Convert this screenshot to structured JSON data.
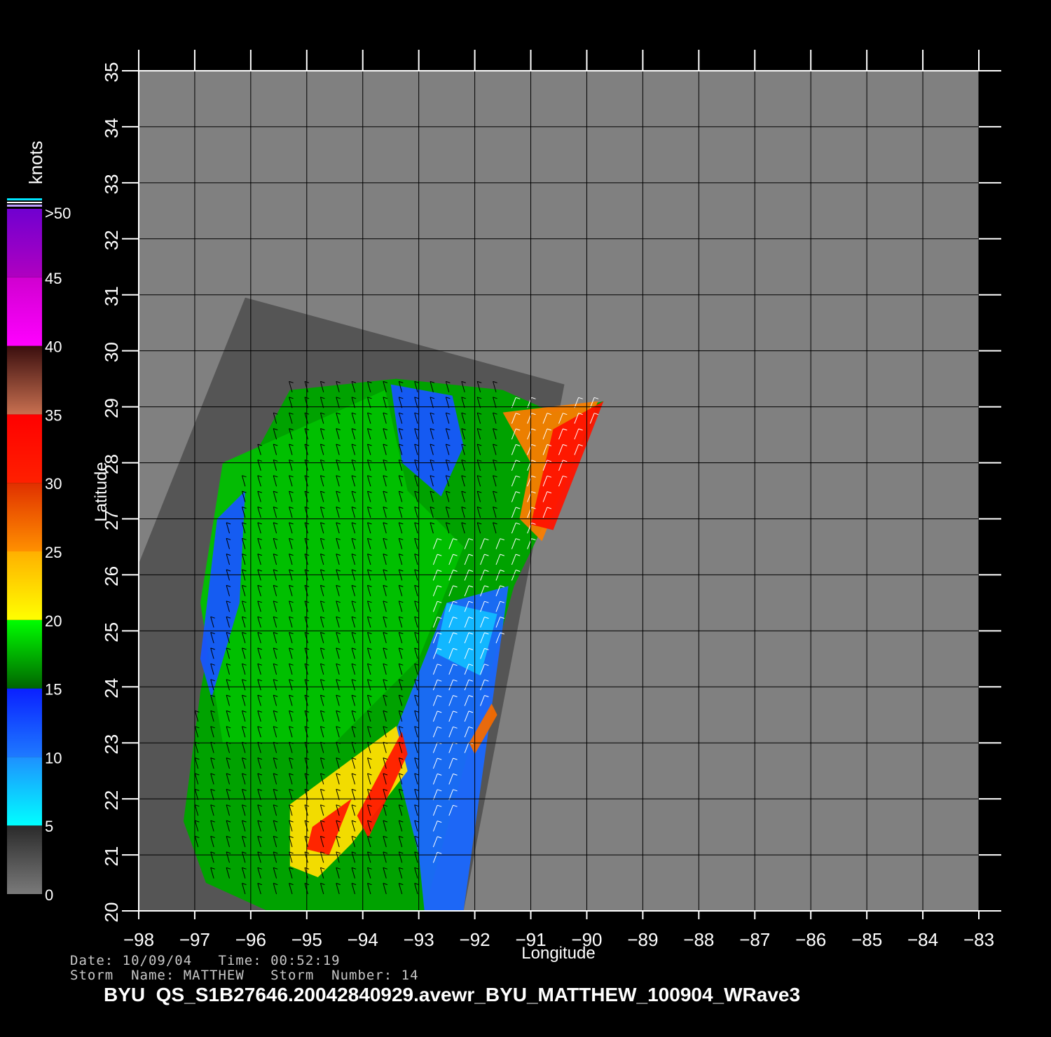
{
  "map": {
    "type": "scatterometer-wind-map",
    "xlabel": "Longitude",
    "ylabel": "Latitude",
    "lon_range": [
      -98,
      -83
    ],
    "lat_range": [
      20,
      35
    ],
    "lon_ticks": [
      "−98",
      "−97",
      "−96",
      "−95",
      "−94",
      "−93",
      "−92",
      "−91",
      "−90",
      "−89",
      "−88",
      "−87",
      "−86",
      "−85",
      "−84",
      "−83"
    ],
    "lat_ticks": [
      "20",
      "21",
      "22",
      "23",
      "24",
      "25",
      "26",
      "27",
      "28",
      "29",
      "30",
      "31",
      "32",
      "33",
      "34",
      "35"
    ],
    "grid": true,
    "background_color": "#808080",
    "land_color": "#555555"
  },
  "colorbar": {
    "unit_label": "knots",
    "tick_labels": [
      ">50",
      "45",
      "40",
      "35",
      "30",
      "25",
      "20",
      "15",
      "10",
      "5",
      "0"
    ],
    "segments": [
      {
        "from": 0,
        "to": 5,
        "colors": [
          "#7a7a7a",
          "#2a2a2a"
        ]
      },
      {
        "from": 5,
        "to": 10,
        "colors": [
          "#00ffff",
          "#1e90ff"
        ]
      },
      {
        "from": 10,
        "to": 15,
        "colors": [
          "#1e7aff",
          "#0a20ff"
        ]
      },
      {
        "from": 15,
        "to": 20,
        "colors": [
          "#006400",
          "#00ff00"
        ]
      },
      {
        "from": 20,
        "to": 25,
        "colors": [
          "#ffff00",
          "#ffb000"
        ]
      },
      {
        "from": 25,
        "to": 30,
        "colors": [
          "#ff9000",
          "#e03000"
        ]
      },
      {
        "from": 30,
        "to": 35,
        "colors": [
          "#ff2000",
          "#ff0000"
        ]
      },
      {
        "from": 35,
        "to": 40,
        "colors": [
          "#c87050",
          "#3a0e0e"
        ]
      },
      {
        "from": 40,
        "to": 45,
        "colors": [
          "#ff00ff",
          "#d000d0"
        ]
      },
      {
        "from": 45,
        "to": 50,
        "colors": [
          "#b000c0",
          "#7000d0"
        ]
      }
    ]
  },
  "info": {
    "line1": "Date: 10/09/04   Time: 00:52:19",
    "line2": "Storm  Name: MATTHEW   Storm  Number: 14"
  },
  "title": "BYU  QS_S1B27646.20042840929.avewr_BYU_MATTHEW_100904_WRave3",
  "chart_data": {
    "type": "heatmap",
    "title": "BYU  QS_S1B27646.20042840929.avewr_BYU_MATTHEW_100904_WRave3",
    "xlabel": "Longitude",
    "ylabel": "Latitude",
    "xlim": [
      -98,
      -83
    ],
    "ylim": [
      20,
      35
    ],
    "color_unit": "knots",
    "color_range": [
      0,
      50
    ],
    "swath_outline_lonlat": [
      [
        -96.1,
        30.95
      ],
      [
        -90.4,
        29.4
      ],
      [
        -92.2,
        20.0
      ],
      [
        -98.0,
        20.0
      ],
      [
        -98.0,
        26.2
      ]
    ],
    "valid_data_outline_lonlat": [
      [
        -95.3,
        29.3
      ],
      [
        -93.4,
        29.5
      ],
      [
        -91.5,
        29.3
      ],
      [
        -90.6,
        28.9
      ],
      [
        -89.7,
        29.1
      ],
      [
        -91.3,
        25.8
      ],
      [
        -92.1,
        22.9
      ],
      [
        -92.9,
        20.0
      ],
      [
        -95.7,
        20.0
      ],
      [
        -96.8,
        20.5
      ],
      [
        -97.2,
        21.6
      ],
      [
        -96.9,
        23.9
      ],
      [
        -96.4,
        26.7
      ],
      [
        -95.9,
        28.2
      ]
    ],
    "wind_regions": [
      {
        "label": "core green 15-20 kt",
        "knots": 18,
        "lonlat": [
          [
            -96.5,
            28.0
          ],
          [
            -93.6,
            29.3
          ],
          [
            -93.2,
            27.5
          ],
          [
            -92.2,
            26.5
          ],
          [
            -93.0,
            24.5
          ],
          [
            -94.5,
            23.0
          ],
          [
            -96.5,
            23.0
          ],
          [
            -96.9,
            25.5
          ]
        ]
      },
      {
        "label": "north-east blue band",
        "knots": 12,
        "lonlat": [
          [
            -93.5,
            29.4
          ],
          [
            -92.4,
            29.2
          ],
          [
            -92.2,
            28.3
          ],
          [
            -92.6,
            27.4
          ],
          [
            -93.3,
            28.0
          ]
        ]
      },
      {
        "label": "west coastal blue band",
        "knots": 12,
        "lonlat": [
          [
            -96.6,
            27.0
          ],
          [
            -96.1,
            27.5
          ],
          [
            -96.2,
            25.5
          ],
          [
            -96.7,
            23.8
          ],
          [
            -96.9,
            24.5
          ]
        ]
      },
      {
        "label": "south-east blue band",
        "knots": 11,
        "lonlat": [
          [
            -91.4,
            25.8
          ],
          [
            -92.5,
            25.5
          ],
          [
            -93.5,
            23.0
          ],
          [
            -93.0,
            21.0
          ],
          [
            -92.9,
            20.0
          ],
          [
            -92.2,
            20.0
          ]
        ]
      },
      {
        "label": "cyan patch",
        "knots": 8,
        "lonlat": [
          [
            -92.5,
            25.5
          ],
          [
            -91.6,
            25.3
          ],
          [
            -91.9,
            24.2
          ],
          [
            -92.7,
            24.6
          ]
        ]
      },
      {
        "label": "north-east yellow-orange",
        "knots": 26,
        "lonlat": [
          [
            -91.5,
            28.9
          ],
          [
            -89.8,
            29.1
          ],
          [
            -90.8,
            26.6
          ],
          [
            -91.2,
            27.0
          ],
          [
            -91.0,
            28.0
          ]
        ]
      },
      {
        "label": "north-east red edge",
        "knots": 32,
        "lonlat": [
          [
            -90.6,
            28.6
          ],
          [
            -89.7,
            29.1
          ],
          [
            -90.6,
            26.8
          ],
          [
            -91.0,
            26.9
          ]
        ]
      },
      {
        "label": "south rainband yellow",
        "knots": 22,
        "lonlat": [
          [
            -95.3,
            21.9
          ],
          [
            -93.4,
            23.3
          ],
          [
            -93.2,
            22.5
          ],
          [
            -94.2,
            21.2
          ],
          [
            -94.8,
            20.6
          ],
          [
            -95.3,
            20.8
          ]
        ]
      },
      {
        "label": "south rainband red",
        "knots": 31,
        "lonlat": [
          [
            -94.9,
            21.5
          ],
          [
            -94.2,
            22.0
          ],
          [
            -94.6,
            21.0
          ],
          [
            -95.0,
            21.1
          ]
        ]
      },
      {
        "label": "south rainband red 2",
        "knots": 31,
        "lonlat": [
          [
            -93.3,
            23.2
          ],
          [
            -93.2,
            22.8
          ],
          [
            -93.9,
            21.3
          ],
          [
            -94.1,
            21.7
          ]
        ]
      },
      {
        "label": "south-east small orange streak",
        "knots": 27,
        "lonlat": [
          [
            -91.7,
            23.7
          ],
          [
            -91.6,
            23.5
          ],
          [
            -92.0,
            22.8
          ],
          [
            -92.1,
            23.0
          ]
        ]
      }
    ]
  }
}
